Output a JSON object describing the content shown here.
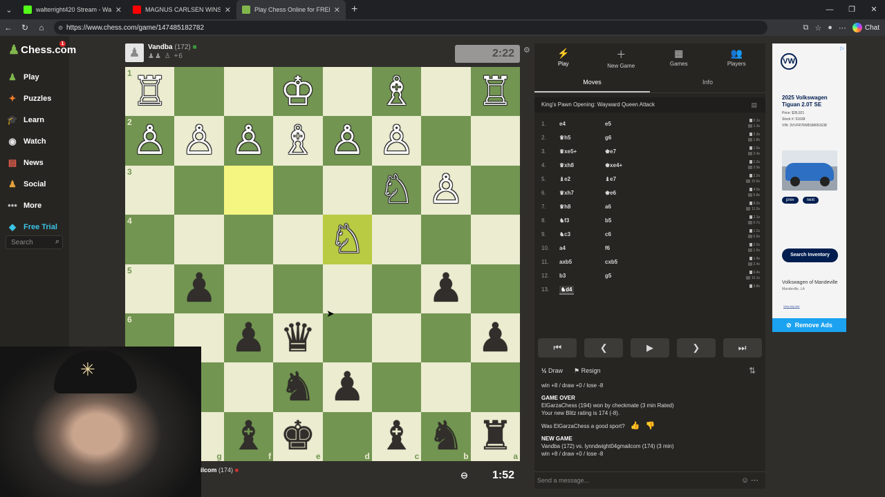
{
  "browser": {
    "tabs": [
      {
        "title": "walterright420 Stream - Watch Liv",
        "color": "#53fc18"
      },
      {
        "title": "MAGNUS CARLSEN WINS WORLD",
        "color": "#ff0000"
      },
      {
        "title": "Play Chess Online for FREE - 2",
        "color": "#81b64c"
      }
    ],
    "url": "https://www.chess.com/game/147485182782",
    "chat_label": "Chat"
  },
  "sidebar": {
    "logo": "Chess.com",
    "badge": "1",
    "items": [
      {
        "label": "Play",
        "icon": "♟",
        "color": "#81b64c"
      },
      {
        "label": "Puzzles",
        "icon": "✦",
        "color": "#f07c2a"
      },
      {
        "label": "Learn",
        "icon": "🎓",
        "color": "#5aa6e4"
      },
      {
        "label": "Watch",
        "icon": "◉",
        "color": "#e3e3e3"
      },
      {
        "label": "News",
        "icon": "▤",
        "color": "#e25c4b"
      },
      {
        "label": "Social",
        "icon": "♟",
        "color": "#e3a03b"
      },
      {
        "label": "More",
        "icon": "•••",
        "color": "#bbbbbb"
      },
      {
        "label": "Free Trial",
        "icon": "◆",
        "color": "#3bc4e6",
        "accent": true
      }
    ],
    "search_placeholder": "Search"
  },
  "top_player": {
    "name": "Vandba",
    "rating": "(172)",
    "captured": "♟♟ ♙ +6",
    "clock": "2:22"
  },
  "bottom_player": {
    "name": "ilcom",
    "rating": "(174)",
    "clock": "1:52"
  },
  "board": {
    "ranks": [
      "1",
      "2",
      "3",
      "4",
      "5",
      "6",
      "7",
      "8"
    ],
    "files": [
      "h",
      "g",
      "f",
      "e",
      "d",
      "c",
      "b",
      "a"
    ],
    "squares": [
      [
        "wR",
        "",
        "",
        "wK",
        "",
        "wB",
        "",
        "wR"
      ],
      [
        "wP",
        "wP",
        "wP",
        "wB",
        "wP",
        "wP",
        "",
        ""
      ],
      [
        "",
        "",
        "",
        "",
        "",
        "wN",
        "wP",
        ""
      ],
      [
        "",
        "",
        "",
        "",
        "wN",
        "",
        "",
        ""
      ],
      [
        "",
        "bP",
        "",
        "",
        "",
        "",
        "bP",
        ""
      ],
      [
        "",
        "",
        "bP",
        "bQ",
        "",
        "",
        "",
        "bP"
      ],
      [
        "",
        "",
        "",
        "bN",
        "bP",
        "",
        "",
        ""
      ],
      [
        "",
        "",
        "bB",
        "bK",
        "",
        "bB",
        "bN",
        "bR"
      ]
    ],
    "highlights": [
      [
        2,
        2
      ],
      [
        3,
        4
      ]
    ]
  },
  "panel": {
    "tabs": [
      {
        "label": "Play",
        "icon": "⚡"
      },
      {
        "label": "New Game",
        "icon": "＋"
      },
      {
        "label": "Games",
        "icon": "▦"
      },
      {
        "label": "Players",
        "icon": "👥"
      }
    ],
    "subtabs": [
      "Moves",
      "Info"
    ],
    "opening": "King's Pawn Opening: Wayward Queen Attack",
    "moves": [
      {
        "n": "1.",
        "w": "e4",
        "b": "e5",
        "tw": "0.1s",
        "tb": "1.3s"
      },
      {
        "n": "2.",
        "w": "♛h5",
        "b": "g6",
        "tw": "2.3s",
        "tb": "1.8s"
      },
      {
        "n": "3.",
        "w": "♛xe5+",
        "b": "♚e7",
        "tw": "1.5s",
        "tb": "2.4s"
      },
      {
        "n": "4.",
        "w": "♛xh8",
        "b": "♚xe4+",
        "tw": "1.2s",
        "tb": "2.9s"
      },
      {
        "n": "5.",
        "w": "♝e2",
        "b": "♝e7",
        "tw": "2.2s",
        "tb": "15.6s"
      },
      {
        "n": "6.",
        "w": "♛xh7",
        "b": "♚e6",
        "tw": "4.0s",
        "tb": "5.8s"
      },
      {
        "n": "7.",
        "w": "♛h8",
        "b": "a6",
        "tw": "8.2s",
        "tb": "11.5s"
      },
      {
        "n": "8.",
        "w": "♞f3",
        "b": "b5",
        "tw": "2.1s",
        "tb": "0.7s"
      },
      {
        "n": "9.",
        "w": "♞c3",
        "b": "c6",
        "tw": "1.2s",
        "tb": "0.9s"
      },
      {
        "n": "10.",
        "w": "a4",
        "b": "f6",
        "tw": "2.2s",
        "tb": "1.5s"
      },
      {
        "n": "11.",
        "w": "axb5",
        "b": "cxb5",
        "tw": "1.4s",
        "tb": "2.4s"
      },
      {
        "n": "12.",
        "w": "b3",
        "b": "g5",
        "tw": "6.4s",
        "tb": "15.1s"
      },
      {
        "n": "13.",
        "w": "♞d4",
        "b": "",
        "tw": "3.8s",
        "tb": ""
      }
    ],
    "draw": "Draw",
    "resign": "Resign",
    "chat": {
      "line1": "win +8 / draw +0 / lose -8",
      "go_title": "GAME OVER",
      "go_line1": "ElGarzaChess (194) won by checkmate (3 min Rated)",
      "go_line2": "Your new Blitz rating is 174 (-8).",
      "sport": "Was ElGarzaChess a good sport?",
      "ng_title": "NEW GAME",
      "ng_line1": "Vandba (172) vs. lynndwight04gmailcom (174) (3 min)",
      "ng_line2": "win +8 / draw +0 / lose -8"
    },
    "message_placeholder": "Send a message..."
  },
  "ad": {
    "model": "2025 Volkswagen Tiguan 2.0T SE",
    "price": "Price: $35,921",
    "stock": "Stock #: 51638",
    "vin": "VIN: 3VVFR7RM5SM051638",
    "prev": "prev",
    "next": "next",
    "cta": "Search Inventory",
    "dealer": "Volkswagen of Mandeville",
    "location": "Mandeville, LA",
    "key_info": "View key info",
    "remove_ads": "Remove Ads"
  }
}
